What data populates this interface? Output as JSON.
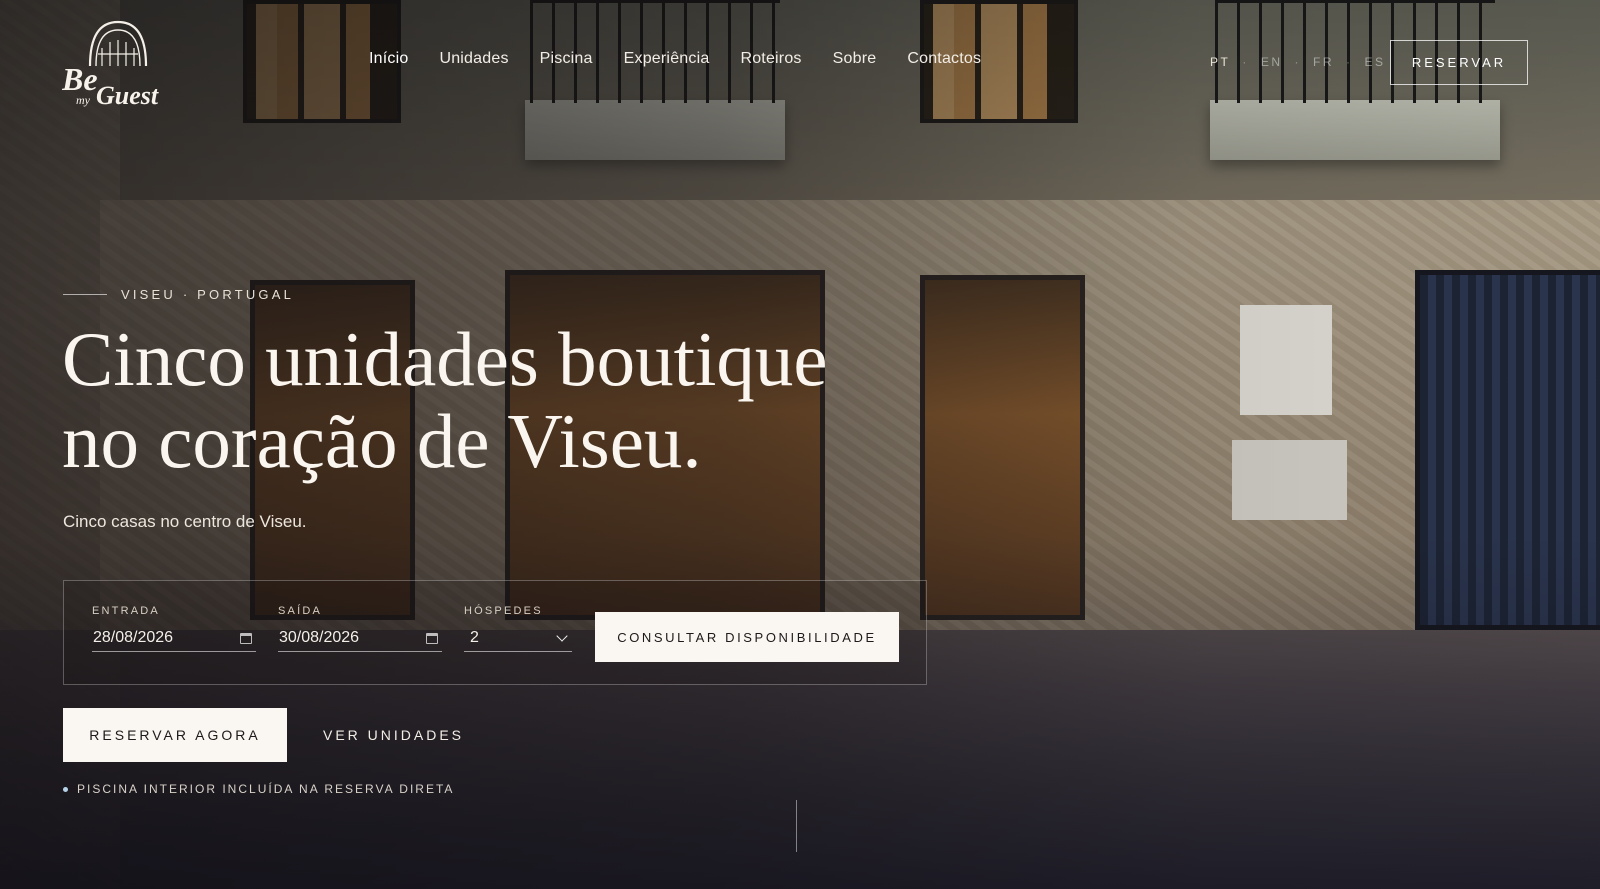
{
  "brand": {
    "logo_text": "Be my Guest"
  },
  "nav": {
    "items": [
      {
        "label": "Início",
        "active": true
      },
      {
        "label": "Unidades"
      },
      {
        "label": "Piscina"
      },
      {
        "label": "Experiência"
      },
      {
        "label": "Roteiros"
      },
      {
        "label": "Sobre"
      },
      {
        "label": "Contactos"
      }
    ]
  },
  "languages": [
    "PT",
    "EN",
    "FR",
    "ES"
  ],
  "active_language": "PT",
  "header": {
    "reserve_label": "RESERVAR"
  },
  "hero": {
    "eyebrow": "VISEU · PORTUGAL",
    "title_line1": "Cinco unidades boutique",
    "title_line2": "no coração de Viseu.",
    "subtitle": "Cinco casas no centro de Viseu."
  },
  "booking": {
    "checkin_label": "ENTRADA",
    "checkin_value": "28/08/2026",
    "checkout_label": "SAÍDA",
    "checkout_value": "30/08/2026",
    "guests_label": "HÓSPEDES",
    "guests_value": "2",
    "submit_label": "CONSULTAR DISPONIBILIDADE"
  },
  "cta": {
    "primary_label": "RESERVAR AGORA",
    "secondary_label": "VER UNIDADES",
    "note": "PISCINA INTERIOR INCLUÍDA NA RESERVA DIRETA"
  },
  "colors": {
    "accent_light": "#faf7f2",
    "note_dot": "#b5d3e8",
    "text_dark": "#1c1a1a"
  }
}
